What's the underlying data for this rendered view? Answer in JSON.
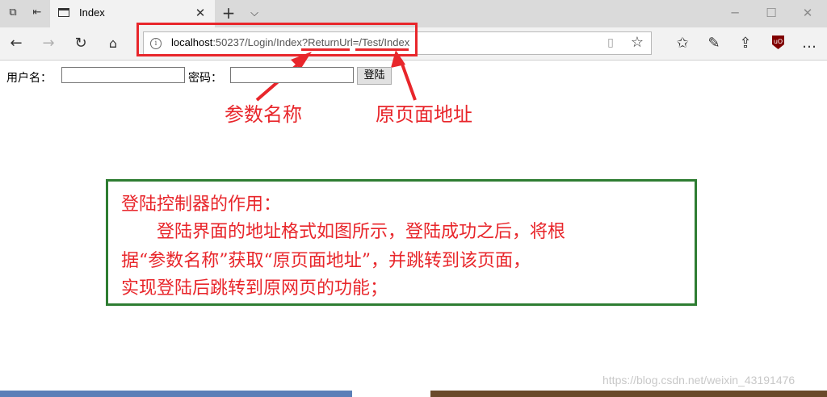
{
  "browser": {
    "tab_title": "Index",
    "url_host": "localhost",
    "url_rest": ":50237/Login/Index?ReturnUrl=/Test/Index",
    "info_glyph": "i"
  },
  "page": {
    "username_label": "用户名：",
    "password_label": "密码：",
    "login_button": "登陆"
  },
  "annotations": {
    "param_name": "参数名称",
    "original_page": "原页面地址",
    "explanation_title": "登陆控制器的作用：",
    "explanation_lines": [
      "　　登陆界面的地址格式如图所示，登陆成功之后，将根",
      "据“参数名称”获取“原页面地址”，并跳转到该页面，",
      "实现登陆后跳转到原网页的功能；"
    ]
  },
  "watermark": "https://blog.csdn.net/weixin_43191476",
  "colors": {
    "annotation_red": "#e8262b",
    "box_green": "#2e7d32"
  }
}
